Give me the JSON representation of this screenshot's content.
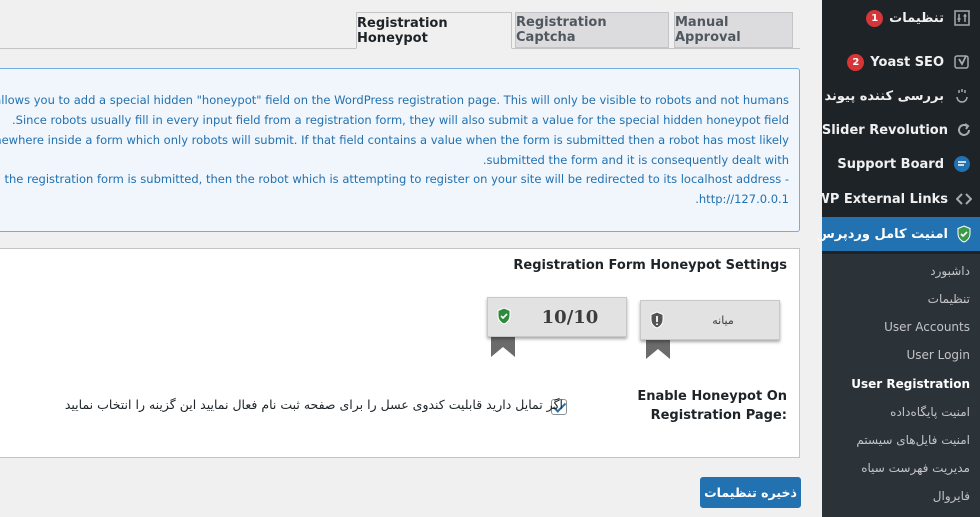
{
  "sidebar": {
    "items": [
      {
        "label": "تنظیمات",
        "badge": "1",
        "icon": "settings-sliders-icon"
      },
      {
        "label": "Yoast SEO",
        "badge": "2",
        "icon": "yoast-icon"
      },
      {
        "label": "بررسی کننده پیوند",
        "icon": "link-checker-icon"
      },
      {
        "label": "Slider Revolution",
        "icon": "refresh-icon"
      },
      {
        "label": "Support Board",
        "icon": "chat-icon"
      },
      {
        "label": "WP External Links",
        "icon": "code-arrows-icon"
      },
      {
        "label": "امنیت کامل وردپرس",
        "icon": "shield-check-icon"
      }
    ],
    "submenu": [
      {
        "label": "داشبورد"
      },
      {
        "label": "تنظیمات"
      },
      {
        "label": "User Accounts"
      },
      {
        "label": "User Login"
      },
      {
        "label": "User Registration",
        "current": true
      },
      {
        "label": "امنیت پایگاه‌داده"
      },
      {
        "label": "امنیت فایل‌های سیستم"
      },
      {
        "label": "مدیریت فهرست سیاه"
      },
      {
        "label": "فایروال"
      }
    ]
  },
  "tabs": [
    {
      "label": "Registration Honeypot",
      "active": true
    },
    {
      "label": "Registration Captcha"
    },
    {
      "label": "Manual Approval"
    }
  ],
  "info": {
    "lines": [
      "ure allows you to add a special hidden \"honeypot\" field on the WordPress registration page. This will only be visible to robots and not humans",
      ".Since robots usually fill in every input field from a registration form, they will also submit a value for the special hidden honeypot field",
      "somewhere inside a form which only robots will submit. If that field contains a value when the form is submitted then a robot has most likely",
      ".submitted the form and it is consequently dealt with",
      "hen the registration form is submitted, then the robot which is attempting to register on your site will be redirected to its localhost address -",
      ".http://127.0.0.1"
    ]
  },
  "settings": {
    "title": "Registration Form Honeypot Settings",
    "score": "10/10",
    "level": "میانه",
    "field_label": "Enable Honeypot On Registration Page:",
    "checkbox_text": "اگر تمایل دارید قابلیت کندوی عسل را برای صفحه ثبت نام فعال نمایید این گزینه را انتخاب نمایید",
    "checked": true
  },
  "save_button": "ذخیره تنظیمات",
  "colors": {
    "sidebar_bg": "#1d2327",
    "accent": "#2271b1",
    "badge": "#d63638",
    "info_bg": "#f0f6fc",
    "shield_green": "#2e8b3d"
  }
}
